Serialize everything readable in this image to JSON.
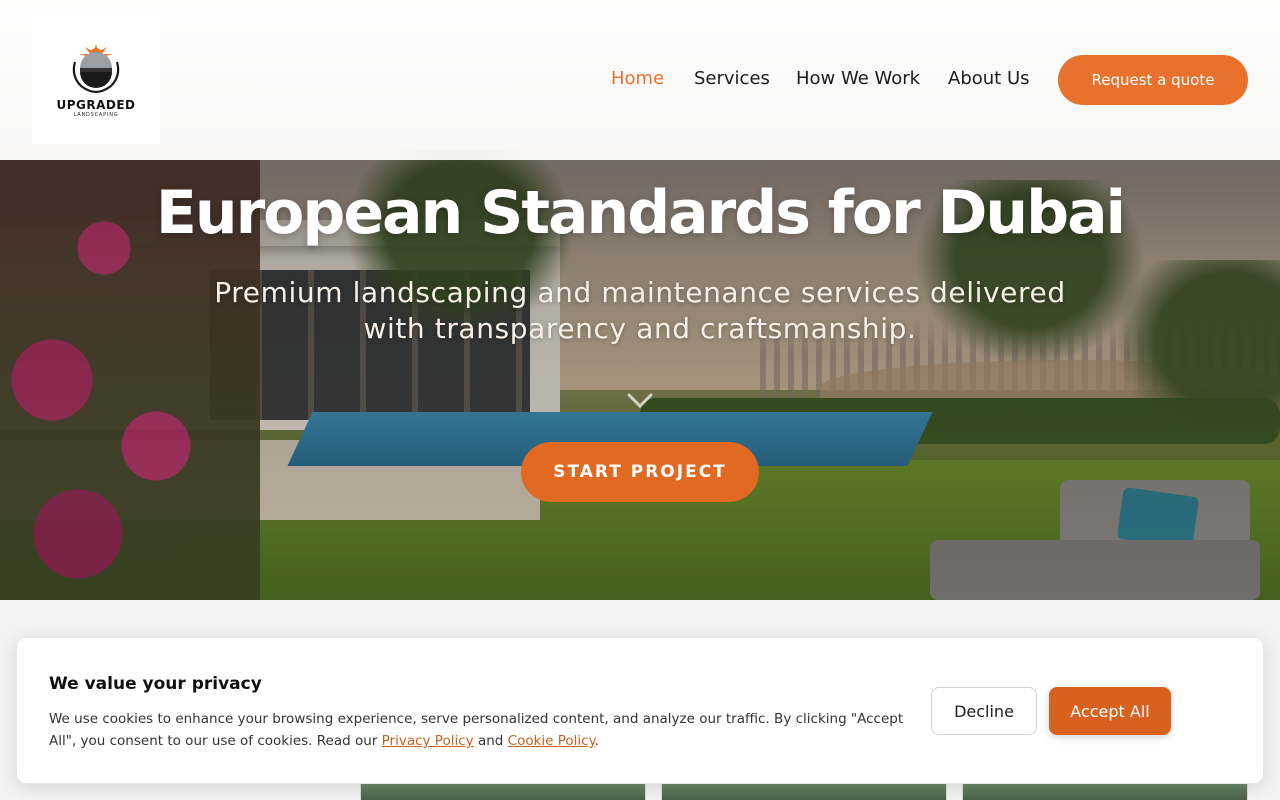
{
  "brand": {
    "name": "UPGRADED",
    "tagline": "LANDSCAPING",
    "accent_color": "#e8722d"
  },
  "nav": {
    "items": [
      {
        "label": "Home",
        "active": true
      },
      {
        "label": "Services",
        "active": false
      },
      {
        "label": "How We Work",
        "active": false
      },
      {
        "label": "About Us",
        "active": false
      }
    ],
    "cta_label": "Request a quote"
  },
  "hero": {
    "title": "European Standards for Dubai",
    "subtitle": "Premium landscaping and maintenance services delivered with transparency and craftsmanship.",
    "scroll_icon": "chevron-down-icon",
    "cta_label": "START PROJECT"
  },
  "cookie_banner": {
    "title": "We value your privacy",
    "text_before": "We use cookies to enhance your browsing experience, serve personalized content, and analyze our traffic. By clicking \"Accept All\", you consent to our use of cookies. Read our ",
    "privacy_link": "Privacy Policy",
    "and_text": " and ",
    "cookie_link": "Cookie Policy",
    "text_after": ".",
    "decline_label": "Decline",
    "accept_label": "Accept All"
  }
}
